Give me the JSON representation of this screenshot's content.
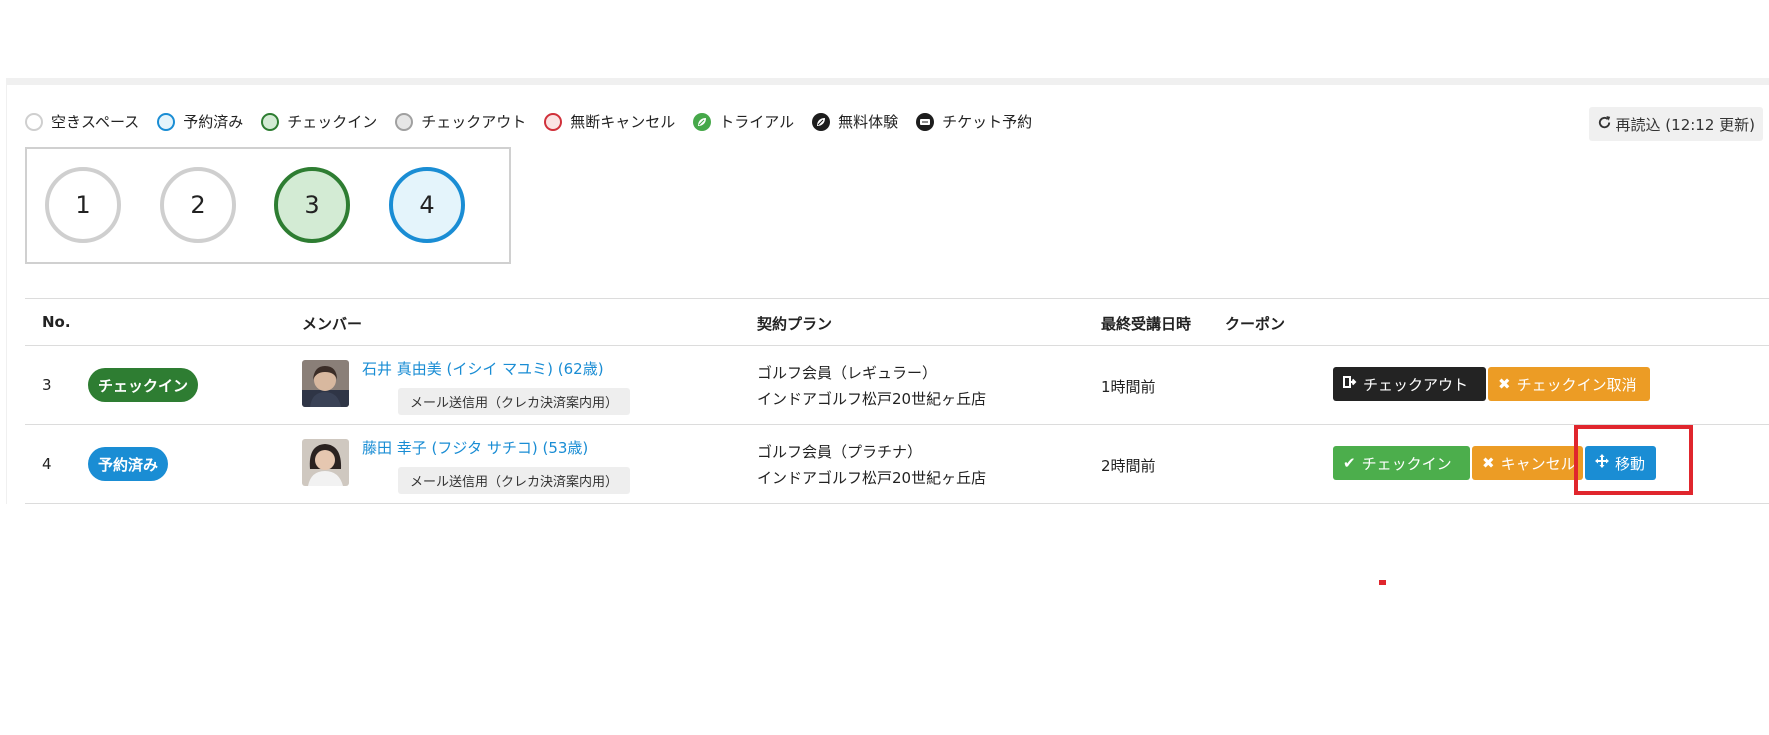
{
  "legend": [
    {
      "label": "空きスペース",
      "kind": "empty"
    },
    {
      "label": "予約済み",
      "kind": "reserved"
    },
    {
      "label": "チェックイン",
      "kind": "checkin"
    },
    {
      "label": "チェックアウト",
      "kind": "checkout"
    },
    {
      "label": "無断キャンセル",
      "kind": "noshow"
    },
    {
      "label": "トライアル",
      "kind": "trial",
      "icon": "leaf-icon"
    },
    {
      "label": "無料体験",
      "kind": "free",
      "icon": "leaf-icon"
    },
    {
      "label": "チケット予約",
      "kind": "ticket",
      "icon": "ticket-icon"
    }
  ],
  "reload": {
    "label": "再読込 (12:12 更新)",
    "icon": "refresh-icon"
  },
  "booths": [
    {
      "number": "1",
      "status": "empty"
    },
    {
      "number": "2",
      "status": "empty"
    },
    {
      "number": "3",
      "status": "checkin"
    },
    {
      "number": "4",
      "status": "reserved"
    }
  ],
  "table": {
    "headers": {
      "no": "No.",
      "member": "メンバー",
      "plan": "契約プラン",
      "last_visit": "最終受講日時",
      "coupon": "クーポン"
    },
    "rows": [
      {
        "no": "3",
        "status": "チェックイン",
        "name": "石井 真由美 (イシイ マユミ) (62歳)",
        "mail_tag": "メール送信用（クレカ決済案内用）",
        "plan": "ゴルフ会員（レギュラー）",
        "store": "インドアゴルフ松戸20世紀ヶ丘店",
        "last_visit": "1時間前",
        "actions": {
          "checkout": "チェックアウト",
          "cancel_checkin": "チェックイン取消"
        }
      },
      {
        "no": "4",
        "status": "予約済み",
        "name": "藤田 幸子 (フジタ サチコ) (53歳)",
        "mail_tag": "メール送信用（クレカ決済案内用）",
        "plan": "ゴルフ会員（プラチナ）",
        "store": "インドアゴルフ松戸20世紀ヶ丘店",
        "last_visit": "2時間前",
        "actions": {
          "checkin": "チェックイン",
          "cancel": "キャンセル",
          "move": "移動"
        }
      }
    ]
  },
  "colors": {
    "accent_blue": "#1a8dd4",
    "checkin_green": "#2e7d32",
    "orange": "#ec9c25",
    "highlight_red": "#e0262d"
  }
}
